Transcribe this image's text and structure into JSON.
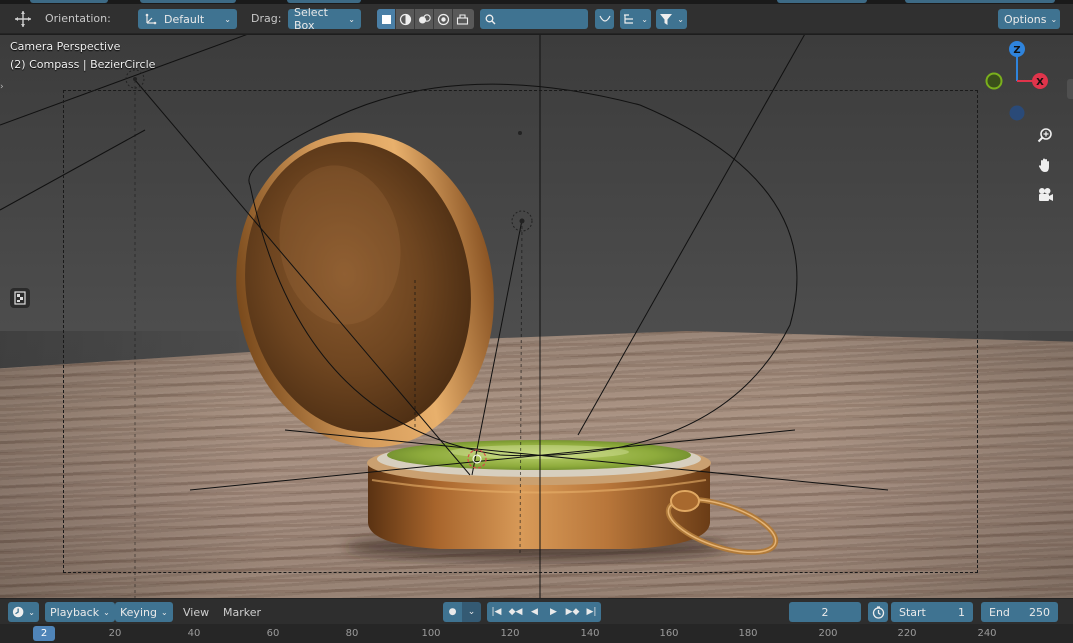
{
  "header": {
    "orientation_label": "Orientation:",
    "orientation_value": "Default",
    "drag_label": "Drag:",
    "drag_value": "Select Box",
    "search_placeholder": "",
    "options_label": "Options"
  },
  "viewport": {
    "camera_label": "Camera Perspective",
    "object_label": "(2) Compass | BezierCircle",
    "gizmo": {
      "z": "Z",
      "x": "X"
    }
  },
  "timeline": {
    "playback_label": "Playback",
    "keying_label": "Keying",
    "view_label": "View",
    "marker_label": "Marker",
    "current_frame": "2",
    "start_label": "Start",
    "start_value": "1",
    "end_label": "End",
    "end_value": "250",
    "ruler_current": "2",
    "ruler_ticks": [
      "20",
      "40",
      "60",
      "80",
      "100",
      "120",
      "140",
      "160",
      "180",
      "200",
      "220",
      "240"
    ]
  },
  "colors": {
    "accent_blue": "#3f7391",
    "axis_x": "#e0344b",
    "axis_y": "#7ab01c",
    "axis_z": "#2f84dc",
    "header_bg": "#303030"
  },
  "icons": {
    "transform": "transform-arrows-icon",
    "orientation": "orientation-axes-icon",
    "view_filter": "filter-icon",
    "hand": "hand-pan-icon",
    "zoom": "zoom-icon",
    "camera": "camera-icon",
    "clock": "clock-icon"
  }
}
